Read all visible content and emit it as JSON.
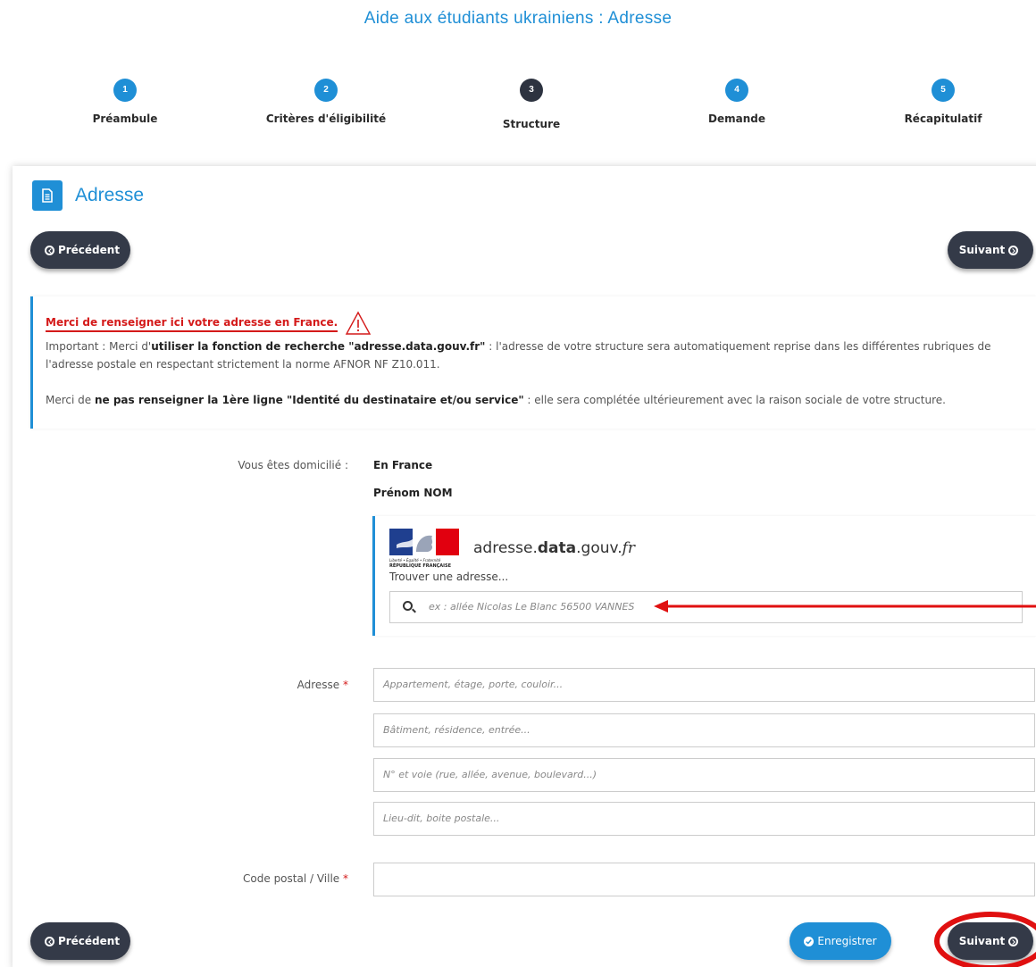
{
  "header": {
    "title": "Aide aux étudiants ukrainiens : Adresse"
  },
  "steps": [
    {
      "num": "1",
      "label": "Préambule",
      "state": "done"
    },
    {
      "num": "2",
      "label": "Critères d'éligibilité",
      "state": "done"
    },
    {
      "num": "3",
      "label": "Structure",
      "state": "active"
    },
    {
      "num": "4",
      "label": "Demande",
      "state": "done"
    },
    {
      "num": "5",
      "label": "Récapitulatif",
      "state": "done"
    }
  ],
  "section": {
    "title": "Adresse",
    "icon": "document-icon"
  },
  "nav": {
    "prev_label": "Précédent",
    "next_label": "Suivant",
    "save_label": "Enregistrer"
  },
  "info": {
    "warning": "Merci de renseigner ici votre adresse en France.",
    "p1_a": "Important : Merci d'",
    "p1_b": "utiliser la fonction de recherche \"adresse.data.gouv.fr\"",
    "p1_c": " : l'adresse de votre structure sera automatiquement reprise dans les différentes rubriques de l'adresse postale en respectant strictement la norme AFNOR NF  Z10.011.",
    "p2_a": "Merci de ",
    "p2_b": "ne pas renseigner la 1ère ligne \"Identité du destinataire et/ou service\"",
    "p2_c": " : elle sera complétée ultérieurement avec la raison sociale de votre structure."
  },
  "domicile": {
    "label": "Vous êtes domicilié :",
    "value": "En France",
    "name": "Prénom NOM"
  },
  "ban": {
    "logo_line1": "Liberté • Égalité • Fraternité",
    "logo_line2": "République Française",
    "brand_a": "adresse.",
    "brand_b": "data",
    "brand_c": ".gouv.",
    "brand_d": "fr",
    "find_label": "Trouver une adresse...",
    "search_placeholder": "ex : allée Nicolas Le Blanc 56500 VANNES"
  },
  "address": {
    "label": "Adresse",
    "required_mark": "*",
    "line1_placeholder": "Appartement, étage, porte, couloir...",
    "line2_placeholder": "Bâtiment, résidence, entrée...",
    "line3_placeholder": "N° et voie (rue, allée, avenue, boulevard...)",
    "line4_placeholder": "Lieu-dit, boite postale..."
  },
  "postal": {
    "label": "Code postal / Ville",
    "required_mark": "*"
  },
  "colors": {
    "accent": "#1f8fd6",
    "dark": "#343a48",
    "annotation": "#e01010"
  }
}
